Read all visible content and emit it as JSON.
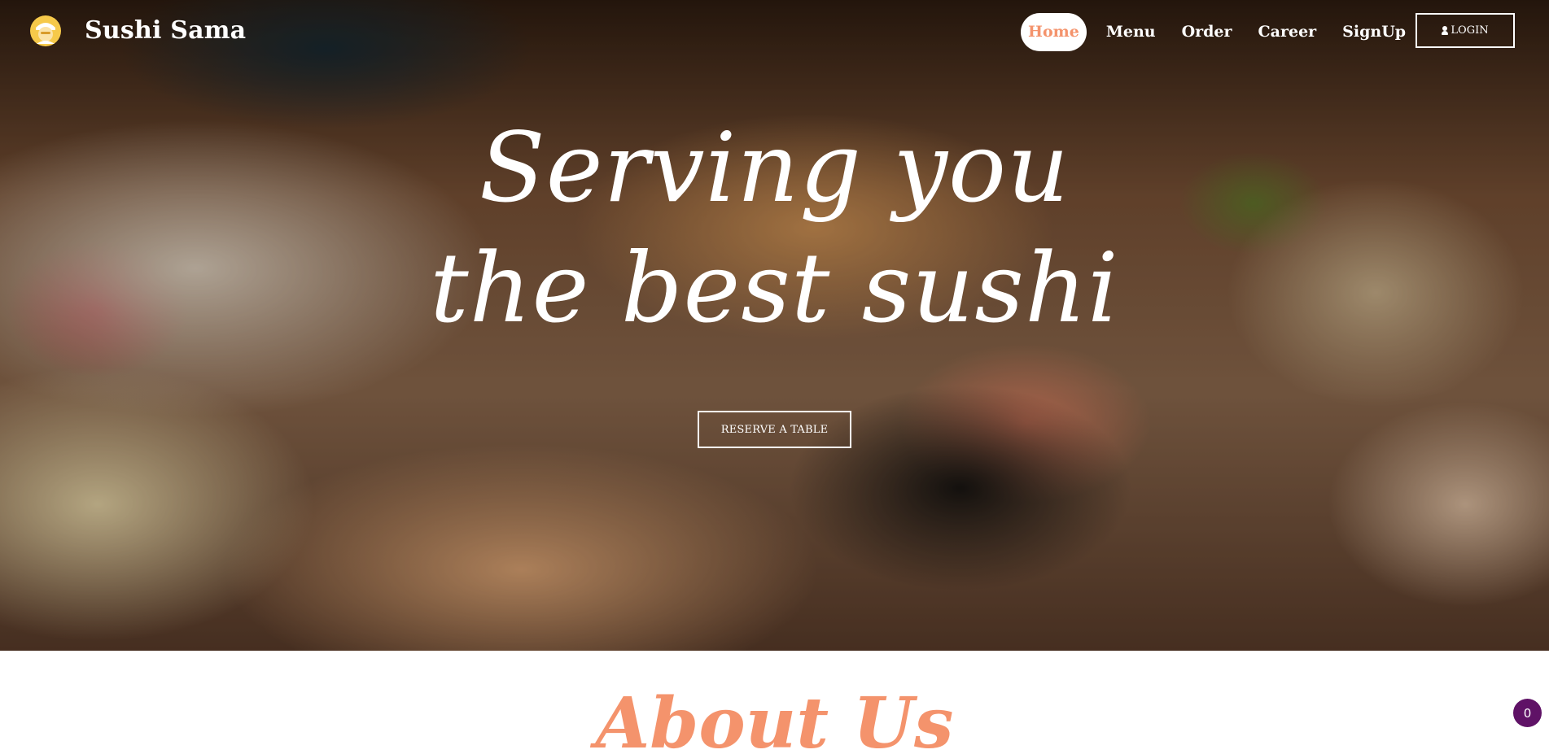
{
  "brand": {
    "name": "Sushi Sama",
    "logo_icon": "sushi-chef-icon"
  },
  "nav": {
    "items": [
      {
        "label": "Home",
        "active": true
      },
      {
        "label": "Menu",
        "active": false
      },
      {
        "label": "Order",
        "active": false
      },
      {
        "label": "Career",
        "active": false
      },
      {
        "label": "SignUp",
        "active": false
      }
    ],
    "login_label": "LOGIN",
    "login_icon": "user-icon"
  },
  "hero": {
    "headline_line1": "Serving you",
    "headline_line2": "the best sushi",
    "reserve_label": "RESERVE A TABLE"
  },
  "about": {
    "title": "About Us"
  },
  "cart": {
    "count": "0"
  },
  "colors": {
    "accent": "#f4936c",
    "badge": "#5f1266",
    "text_on_hero": "#ffffff"
  }
}
